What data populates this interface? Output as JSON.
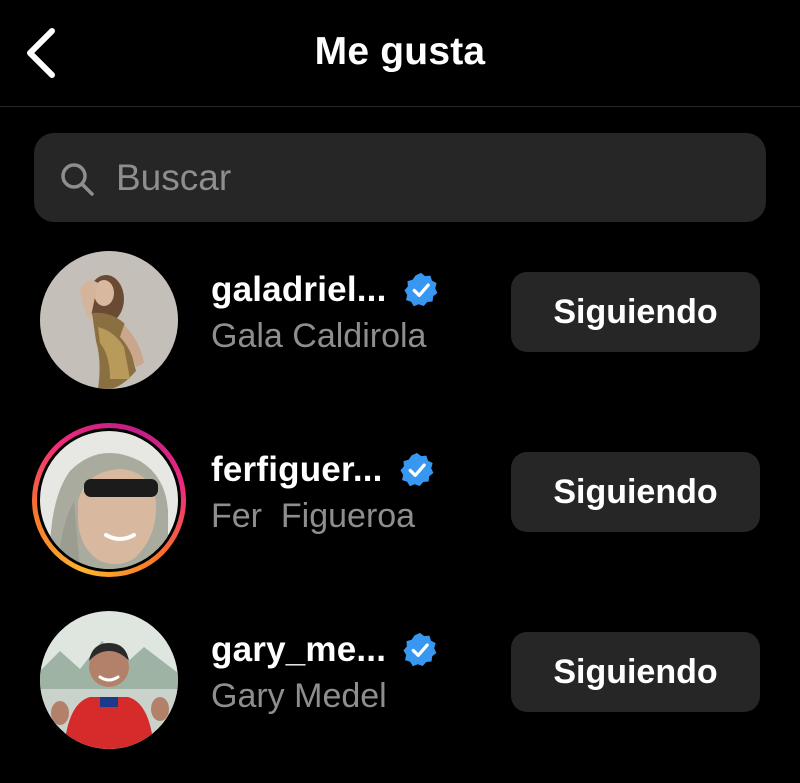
{
  "header": {
    "title": "Me gusta",
    "back_icon": "chevron-left-icon"
  },
  "search": {
    "placeholder": "Buscar",
    "value": "",
    "icon": "search-icon"
  },
  "colors": {
    "background": "#000000",
    "surface": "#262626",
    "text_primary": "#ffffff",
    "text_secondary": "#8e8e8e",
    "verified_blue": "#3897f0"
  },
  "users": [
    {
      "username": "galadriel...",
      "full_name": "Gala Caldirola",
      "verified": true,
      "button_label": "Siguiendo",
      "has_story": false
    },
    {
      "username": "ferfiguer...",
      "full_name": "Fer  Figueroa",
      "verified": true,
      "button_label": "Siguiendo",
      "has_story": true
    },
    {
      "username": "gary_me...",
      "full_name": "Gary Medel",
      "verified": true,
      "button_label": "Siguiendo",
      "has_story": false
    }
  ]
}
